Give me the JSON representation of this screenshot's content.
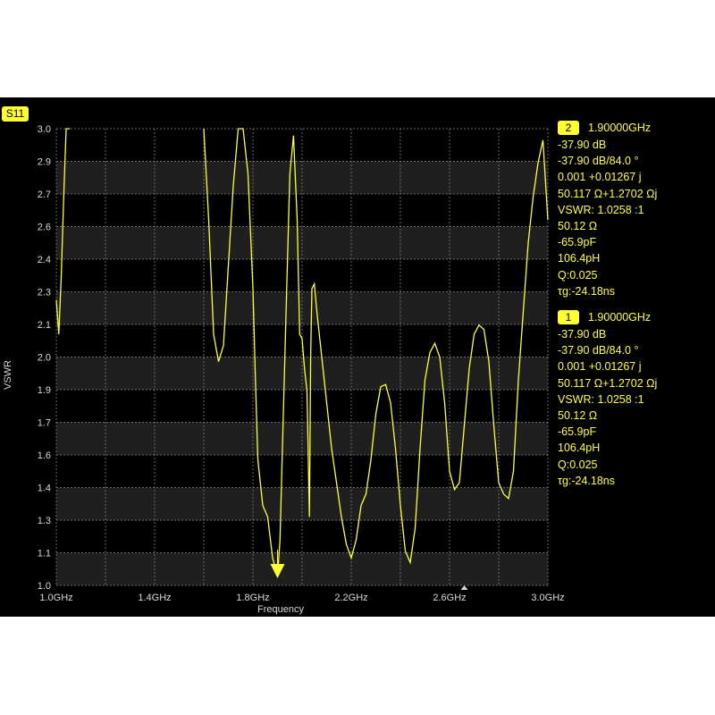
{
  "trace_label": "S11",
  "markers": [
    {
      "id": "2",
      "frequency": "1.90000GHz",
      "lines": [
        "-37.90 dB",
        "-37.90 dB/84.0 °",
        "0.001 +0.01267 j",
        "50.117 Ω+1.2702 Ωj",
        "VSWR: 1.0258 :1",
        "50.12 Ω",
        "-65.9pF",
        "106.4pH",
        "Q:0.025",
        "τg:-24.18ns"
      ]
    },
    {
      "id": "1",
      "frequency": "1.90000GHz",
      "lines": [
        "-37.90 dB",
        "-37.90 dB/84.0 °",
        "0.001 +0.01267 j",
        "50.117 Ω+1.2702 Ωj",
        "VSWR: 1.0258 :1",
        "50.12 Ω",
        "-65.9pF",
        "106.4pH",
        "Q:0.025",
        "τg:-24.18ns"
      ]
    }
  ],
  "colors": {
    "trace": "#ffff33",
    "background": "#000000",
    "band": "#1f1f1f",
    "grid": "#6a6a6a",
    "text": "#d8d8d8"
  },
  "chart_data": {
    "type": "line",
    "xlabel": "Frequency",
    "ylabel": "VSWR",
    "xlim": [
      1.0,
      3.0
    ],
    "ylim": [
      1.0,
      3.0
    ],
    "x_ticks": [
      "1.0GHz",
      "1.4GHz",
      "1.8GHz",
      "2.2GHz",
      "2.6GHz",
      "3.0GHz"
    ],
    "y_ticks": [
      "1.0",
      "1.1",
      "1.3",
      "1.4",
      "1.6",
      "1.7",
      "1.9",
      "2.0",
      "2.1",
      "2.3",
      "2.4",
      "2.6",
      "2.7",
      "2.9",
      "3.0"
    ],
    "series": [
      {
        "x": [
          1.0,
          1.01,
          1.02,
          1.03,
          1.04,
          1.05,
          1.055,
          1.6,
          1.62,
          1.64,
          1.66,
          1.68,
          1.7,
          1.72,
          1.74,
          1.76,
          1.78,
          1.8,
          1.81,
          1.82,
          1.84,
          1.86,
          1.88,
          1.9,
          1.91,
          1.92,
          1.935,
          1.95,
          1.965,
          1.98,
          1.99,
          2.0,
          2.01,
          2.02,
          2.03,
          2.035,
          2.04,
          2.05,
          2.06,
          2.08,
          2.1,
          2.12,
          2.14,
          2.16,
          2.18,
          2.2,
          2.22,
          2.24,
          2.26,
          2.28,
          2.3,
          2.32,
          2.34,
          2.36,
          2.38,
          2.4,
          2.42,
          2.44,
          2.46,
          2.48,
          2.5,
          2.52,
          2.54,
          2.56,
          2.58,
          2.6,
          2.62,
          2.64,
          2.66,
          2.68,
          2.7,
          2.72,
          2.74,
          2.76,
          2.78,
          2.8,
          2.82,
          2.84,
          2.86,
          2.88,
          2.9,
          2.92,
          2.94,
          2.96,
          2.98,
          3.0
        ],
        "y": [
          2.25,
          2.1,
          2.35,
          2.7,
          3.0,
          3.0,
          3.0,
          3.0,
          2.6,
          2.1,
          1.98,
          2.05,
          2.4,
          2.75,
          3.0,
          3.0,
          2.8,
          2.3,
          1.9,
          1.55,
          1.35,
          1.3,
          1.12,
          1.04,
          1.2,
          1.6,
          2.2,
          2.8,
          2.97,
          2.6,
          2.1,
          2.08,
          1.95,
          1.85,
          1.3,
          2.0,
          2.3,
          2.32,
          2.2,
          2.0,
          1.8,
          1.6,
          1.45,
          1.3,
          1.18,
          1.12,
          1.2,
          1.35,
          1.4,
          1.55,
          1.75,
          1.87,
          1.88,
          1.8,
          1.6,
          1.35,
          1.15,
          1.1,
          1.25,
          1.6,
          1.9,
          2.02,
          2.06,
          2.0,
          1.8,
          1.5,
          1.42,
          1.45,
          1.7,
          1.95,
          2.1,
          2.14,
          2.12,
          1.98,
          1.7,
          1.45,
          1.4,
          1.38,
          1.5,
          1.9,
          2.2,
          2.5,
          2.7,
          2.85,
          2.95,
          2.6
        ]
      }
    ],
    "markers": [
      {
        "id": "2",
        "x": 1.9
      },
      {
        "id": "1",
        "x": 1.9
      }
    ]
  }
}
